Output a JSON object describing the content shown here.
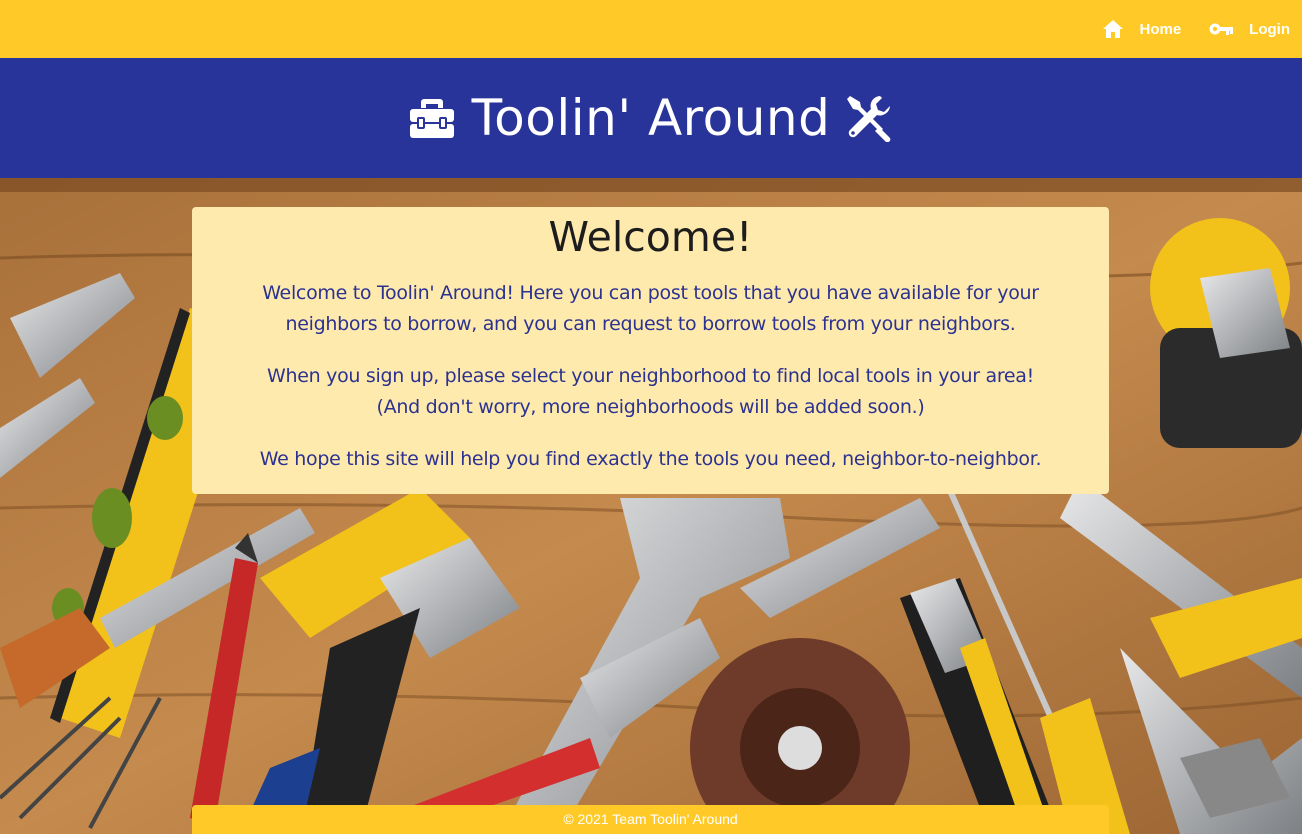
{
  "nav": {
    "home_label": "Home",
    "login_label": "Login"
  },
  "header": {
    "title": "Toolin' Around",
    "left_icon": "toolbox-icon",
    "right_icon": "tools-icon"
  },
  "welcome": {
    "heading": "Welcome!",
    "paragraph_1_line_1": "Welcome to Toolin' Around! Here you can post tools that you have available for your",
    "paragraph_1_line_2": "neighbors to borrow, and you can request to borrow tools from your neighbors.",
    "paragraph_2_line_1": "When you sign up, please select your neighborhood to find local tools in your area!",
    "paragraph_2_line_2": "(And don't worry, more neighborhoods will be added soon.)",
    "paragraph_3": "We hope this site will help you find exactly the tools you need, neighbor-to-neighbor."
  },
  "footer": {
    "copyright": "© 2021 Team Toolin' Around"
  },
  "colors": {
    "nav_bg": "#ffca28",
    "header_bg": "#29349a",
    "card_bg": "#ffeaae",
    "card_text": "#2b3290"
  }
}
